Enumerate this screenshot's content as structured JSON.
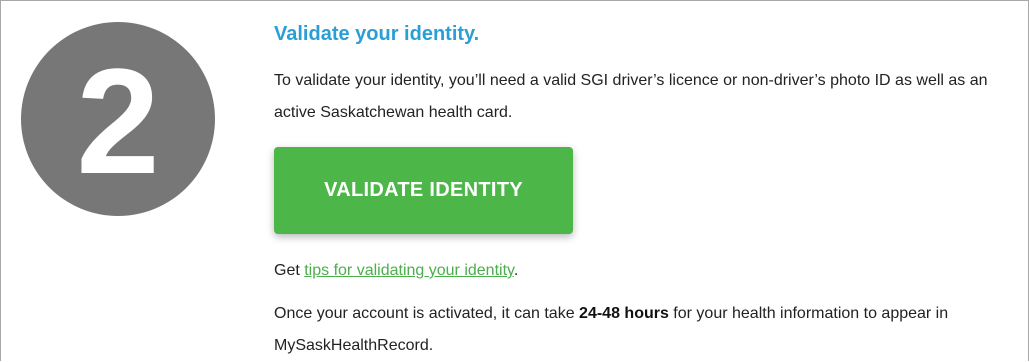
{
  "step": {
    "number": "2"
  },
  "section": {
    "title": "Validate your identity.",
    "description": "To validate your identity, you’ll need a valid SGI driver’s licence or non-driver’s photo ID as well as an active Saskatchewan health card."
  },
  "button": {
    "label": "VALIDATE IDENTITY"
  },
  "tips": {
    "prefix": "Get ",
    "link_text": "tips for validating your identity",
    "suffix": "."
  },
  "note": {
    "before": "Once your account is activated, it can take ",
    "bold": "24-48 hours",
    "after": " for your health information to appear in MySaskHealthRecord."
  },
  "colors": {
    "title": "#2a9fd6",
    "button": "#4cb648",
    "link": "#4cae4c",
    "circle": "#777777"
  }
}
